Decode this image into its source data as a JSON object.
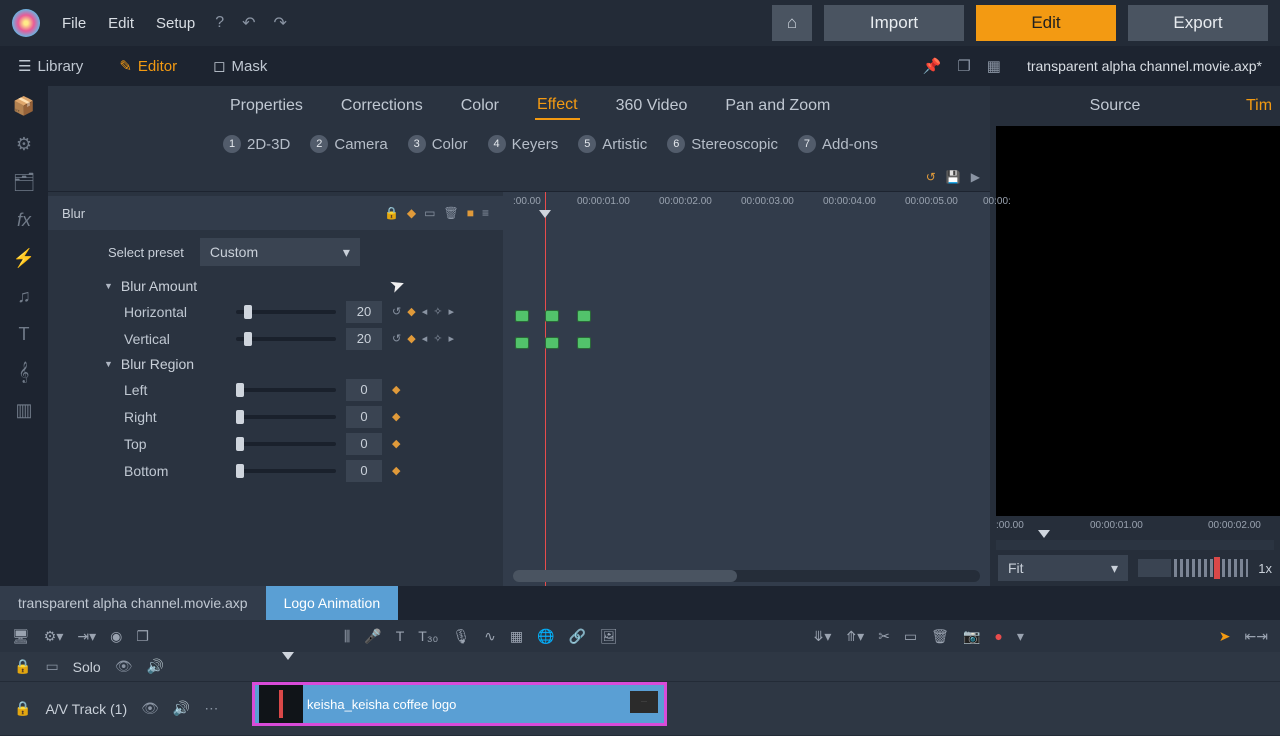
{
  "menus": {
    "file": "File",
    "edit": "Edit",
    "setup": "Setup"
  },
  "top_buttons": {
    "import": "Import",
    "edit": "Edit",
    "export": "Export"
  },
  "views": {
    "library": "Library",
    "editor": "Editor",
    "mask": "Mask"
  },
  "project_title": "transparent alpha channel.movie.axp*",
  "categories": {
    "properties": "Properties",
    "corrections": "Corrections",
    "color": "Color",
    "effect": "Effect",
    "video360": "360 Video",
    "pan": "Pan and Zoom"
  },
  "subcats": {
    "d2d3": "2D-3D",
    "camera": "Camera",
    "color": "Color",
    "keyers": "Keyers",
    "artistic": "Artistic",
    "stereo": "Stereoscopic",
    "addons": "Add-ons"
  },
  "effect": {
    "name": "Blur",
    "preset_label": "Select preset",
    "preset_value": "Custom",
    "groups": {
      "amount": {
        "title": "Blur Amount",
        "horizontal": {
          "label": "Horizontal",
          "value": "20"
        },
        "vertical": {
          "label": "Vertical",
          "value": "20"
        }
      },
      "region": {
        "title": "Blur Region",
        "left": {
          "label": "Left",
          "value": "0"
        },
        "right": {
          "label": "Right",
          "value": "0"
        },
        "top": {
          "label": "Top",
          "value": "0"
        },
        "bottom": {
          "label": "Bottom",
          "value": "0"
        }
      }
    }
  },
  "timeline_ticks": [
    ":00.00",
    "00:00:01.00",
    "00:00:02.00",
    "00:00:03.00",
    "00:00:04.00",
    "00:00:05.00",
    "00:00:"
  ],
  "right": {
    "tab_source": "Source",
    "tab_timeline": "Tim",
    "ticks": [
      ":00.00",
      "00:00:01.00",
      "00:00:02.00"
    ],
    "fit": "Fit",
    "zoom": "1x"
  },
  "sequences": {
    "tab1": "transparent alpha channel.movie.axp",
    "tab2": "Logo Animation"
  },
  "tracks": {
    "solo": "Solo",
    "av": "A/V Track (1)"
  },
  "clip": {
    "name": "keisha_keisha coffee logo"
  }
}
